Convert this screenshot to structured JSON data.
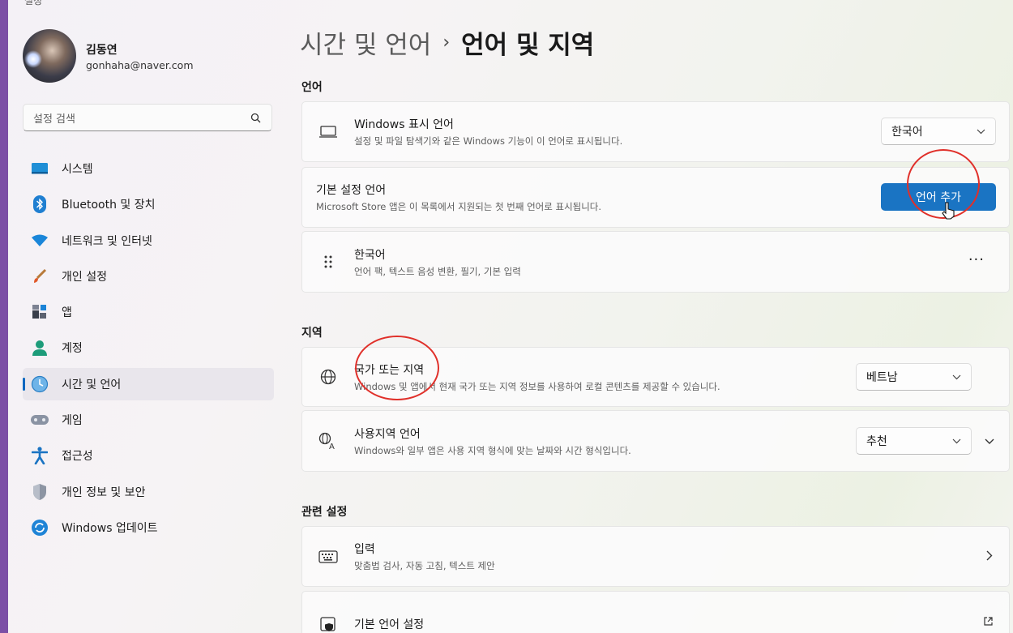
{
  "window": {
    "title": "설정"
  },
  "profile": {
    "name": "김동연",
    "email": "gonhaha@naver.com"
  },
  "search": {
    "placeholder": "설정 검색"
  },
  "nav": [
    {
      "label": "시스템",
      "icon": "system-icon"
    },
    {
      "label": "Bluetooth 및 장치",
      "icon": "bluetooth-icon"
    },
    {
      "label": "네트워크 및 인터넷",
      "icon": "wifi-icon"
    },
    {
      "label": "개인 설정",
      "icon": "paintbrush-icon"
    },
    {
      "label": "앱",
      "icon": "apps-icon"
    },
    {
      "label": "계정",
      "icon": "account-icon"
    },
    {
      "label": "시간 및 언어",
      "icon": "time-language-icon",
      "active": true
    },
    {
      "label": "게임",
      "icon": "gamepad-icon"
    },
    {
      "label": "접근성",
      "icon": "accessibility-icon"
    },
    {
      "label": "개인 정보 및 보안",
      "icon": "shield-icon"
    },
    {
      "label": "Windows 업데이트",
      "icon": "windows-update-icon"
    }
  ],
  "breadcrumb": {
    "parent": "시간 및 언어",
    "separator": "›",
    "current": "언어 및 지역"
  },
  "sections": {
    "language": "언어",
    "region": "지역",
    "related": "관련 설정"
  },
  "cards": {
    "display_language": {
      "title": "Windows 표시 언어",
      "subtitle": "설정 및 파일 탐색기와 같은 Windows 기능이 이 언어로 표시됩니다.",
      "value": "한국어"
    },
    "preferred_languages": {
      "title": "기본 설정 언어",
      "subtitle": "Microsoft Store 앱은 이 목록에서 지원되는 첫 번째 언어로 표시됩니다.",
      "button": "언어 추가"
    },
    "korean": {
      "title": "한국어",
      "subtitle": "언어 팩, 텍스트 음성 변환, 필기, 기본 입력",
      "more": "···"
    },
    "country_region": {
      "title": "국가 또는 지역",
      "subtitle": "Windows 및 앱에서 현재 국가 또는 지역 정보를 사용하여 로컬 콘텐츠를 제공할 수 있습니다.",
      "value": "베트남"
    },
    "regional_format": {
      "title": "사용지역 언어",
      "subtitle": "Windows와 일부 앱은 사용 지역 형식에 맞는 날짜와 시간 형식입니다.",
      "value": "추천"
    },
    "typing": {
      "title": "입력",
      "subtitle": "맞춤법 검사, 자동 고침, 텍스트 제안"
    },
    "admin_language": {
      "title": "기본 언어 설정"
    }
  },
  "colors": {
    "accent": "#1a74c3",
    "annotation": "#e0302a"
  }
}
